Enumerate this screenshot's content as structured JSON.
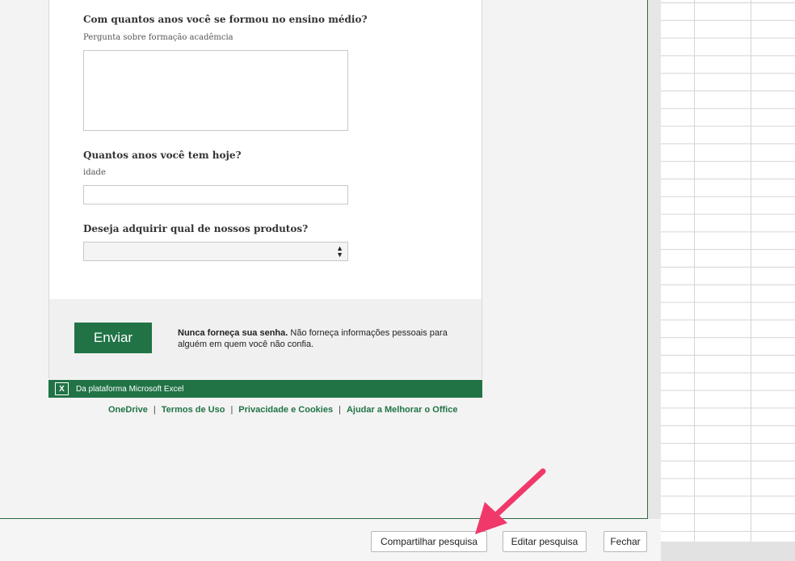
{
  "survey": {
    "q1": {
      "title": "Com quantos anos você se formou no ensino médio?",
      "subtitle": "Pergunta sobre formação acadêmcia"
    },
    "q2": {
      "title": "Quantos anos você tem hoje?",
      "subtitle": "idade"
    },
    "q3": {
      "title": "Deseja adquirir qual de nossos produtos?"
    },
    "submit_label": "Enviar",
    "warning_bold": "Nunca forneça sua senha.",
    "warning_text": " Não forneça informações pessoais para alguém em quem você não confia."
  },
  "excel_bar": {
    "icon": "excel-logo-icon",
    "text": "Da plataforma Microsoft Excel"
  },
  "footer_links": [
    "OneDrive",
    "Termos de Uso",
    "Privacidade e Cookies",
    "Ajudar a Melhorar o Office"
  ],
  "dialog_buttons": {
    "share": "Compartilhar pesquisa",
    "edit": "Editar pesquisa",
    "close": "Fechar"
  },
  "colors": {
    "accent": "#217346",
    "annotation_arrow": "#f0386b"
  }
}
